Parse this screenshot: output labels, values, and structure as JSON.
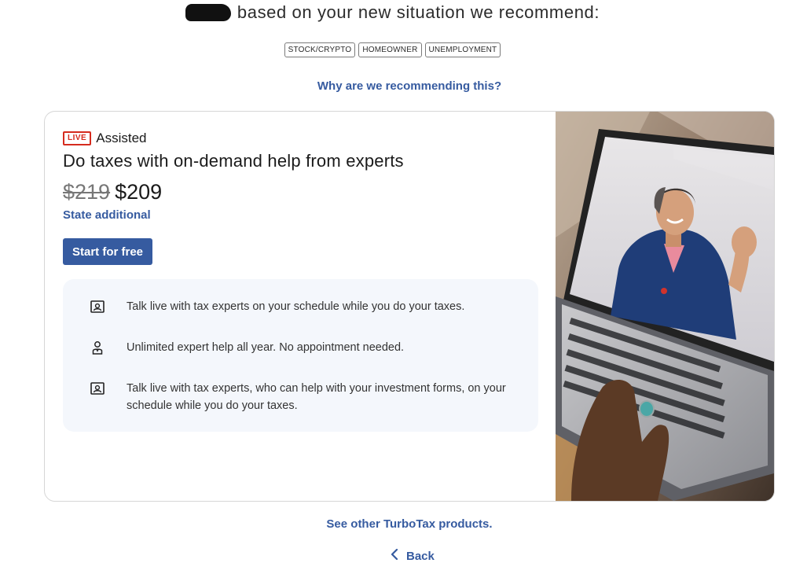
{
  "header": {
    "text": "based on your new situation we recommend:"
  },
  "tags": [
    "STOCK/CRYPTO",
    "HOMEOWNER",
    "UNEMPLOYMENT"
  ],
  "why_link": "Why are we recommending this?",
  "card": {
    "badge": "LIVE",
    "tier": "Assisted",
    "title": "Do taxes with on-demand help from experts",
    "old_price": "$219",
    "new_price": "$209",
    "state_note": "State additional",
    "cta": "Start for free",
    "features": [
      {
        "icon": "expert-screen-icon",
        "text": "Talk live with tax experts on your schedule while you do your taxes."
      },
      {
        "icon": "expert-person-icon",
        "text": "Unlimited expert help all year. No appointment needed."
      },
      {
        "icon": "expert-screen-icon",
        "text": "Talk live with tax experts, who can help with your investment forms, on your schedule while you do your taxes."
      }
    ]
  },
  "footer": {
    "see_other": "See other TurboTax products.",
    "back": "Back"
  },
  "colors": {
    "accent": "#365ba0",
    "live_red": "#d52b1e",
    "feature_bg": "#f4f7fc"
  }
}
